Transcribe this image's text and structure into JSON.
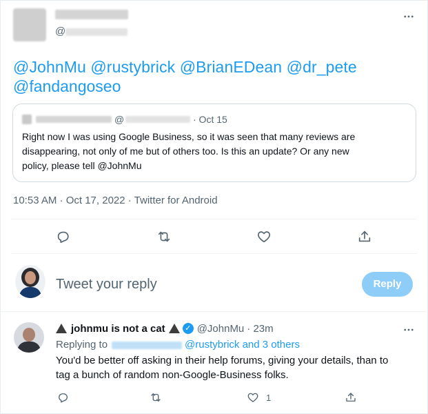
{
  "tweet": {
    "handle_prefix": "@",
    "more_icon": "more-horizontal-icon",
    "mentions_line1": "@JohnMu @rustybrick @BrianEDean @dr_pete",
    "mentions_line2": "@fandangoseo",
    "quoted": {
      "handle_prefix": "@",
      "date": "· Oct 15",
      "text_line1": "Right now I was using Google Business, so it was seen that many reviews are",
      "text_line2": "disappearing, not only of me but of others too. Is this an update? Or any new",
      "text_line3": "policy, please tell @JohnMu"
    },
    "timestamp": "10:53 AM · Oct 17, 2022 · Twitter for Android",
    "actions": [
      "reply-icon",
      "retweet-icon",
      "like-icon",
      "share-icon"
    ]
  },
  "composer": {
    "placeholder": "Tweet your reply",
    "button_label": "Reply"
  },
  "reply": {
    "display_name": "johnmu is not a cat",
    "handle": "@JohnMu",
    "time": "· 23m",
    "replying_prefix": "Replying to",
    "replying_suffix": "@rustybrick and 3 others",
    "text_line1": "You'd be better off asking in their help forums, giving your details, than to",
    "text_line2": "tag a bunch of random non-Google-Business folks.",
    "like_count": "1"
  },
  "colors": {
    "link": "#1d9bf0",
    "verified": "#1d9bf0",
    "reply_button_disabled": "#8ecdf8"
  }
}
